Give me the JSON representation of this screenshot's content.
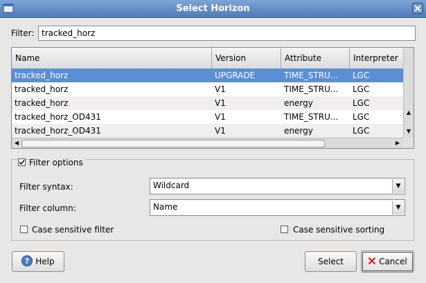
{
  "window": {
    "title": "Select Horizon"
  },
  "filter": {
    "label": "Filter:",
    "value": "tracked_horz"
  },
  "table": {
    "columns": [
      "Name",
      "Version",
      "Attribute",
      "Interpreter"
    ],
    "rows": [
      {
        "name": "tracked_horz",
        "version": "UPGRADE",
        "attribute": "TIME_STRU...",
        "interpreter": "LGC"
      },
      {
        "name": "tracked_horz",
        "version": "V1",
        "attribute": "TIME_STRU...",
        "interpreter": "LGC"
      },
      {
        "name": "tracked_horz",
        "version": "V1",
        "attribute": "energy",
        "interpreter": "LGC"
      },
      {
        "name": "tracked_horz_OD431",
        "version": "V1",
        "attribute": "TIME_STRU...",
        "interpreter": "LGC"
      },
      {
        "name": "tracked_horz_OD431",
        "version": "V1",
        "attribute": "energy",
        "interpreter": "LGC"
      }
    ]
  },
  "filter_options": {
    "label": "Filter options",
    "checked": true,
    "syntax_label": "Filter syntax:",
    "syntax_value": "Wildcard",
    "column_label": "Filter column:",
    "column_value": "Name",
    "case_filter_label": "Case sensitive filter",
    "case_sort_label": "Case sensitive sorting"
  },
  "buttons": {
    "help": "Help",
    "select": "Select",
    "cancel": "Cancel"
  },
  "colors": {
    "selection": "#5b8ed5",
    "titlebar": "#5f89c4",
    "cancel_icon": "#d02020"
  }
}
